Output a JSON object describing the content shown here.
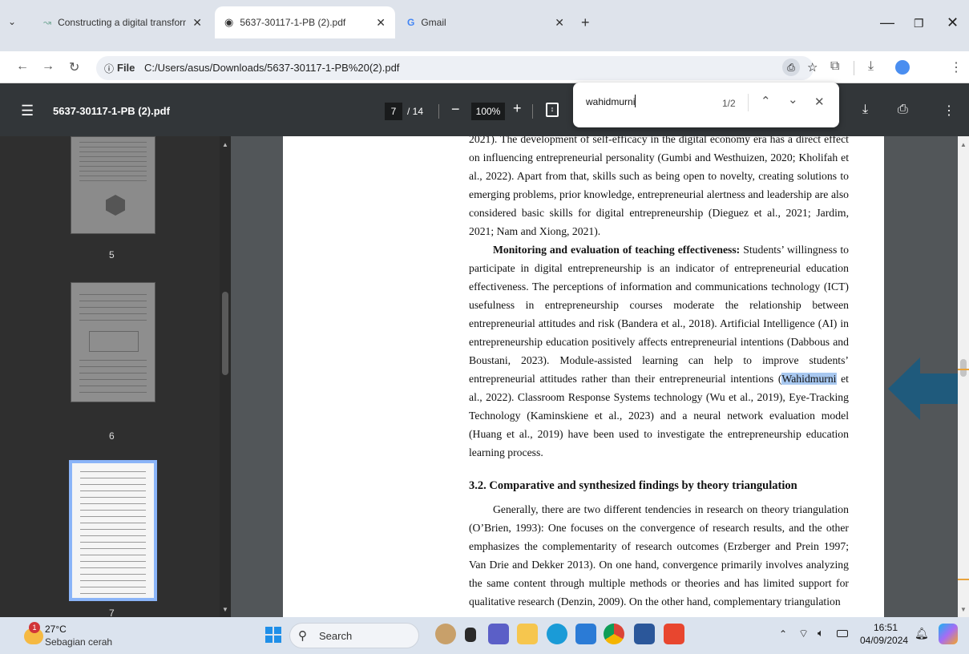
{
  "browser": {
    "tabs": [
      {
        "title": "Constructing a digital transform",
        "active": false
      },
      {
        "title": "5637-30117-1-PB (2).pdf",
        "active": true
      },
      {
        "title": "Gmail",
        "active": false
      }
    ],
    "new_tab_label": "+",
    "address": {
      "scheme_label": "File",
      "url": "C:/Users/asus/Downloads/5637-30117-1-PB%20(2).pdf"
    }
  },
  "pdf_toolbar": {
    "filename": "5637-30117-1-PB (2).pdf",
    "current_page": "7",
    "total_pages": "/ 14",
    "zoom": "100%"
  },
  "find": {
    "query": "wahidmurni",
    "count": "1/2"
  },
  "thumbnails": [
    {
      "label": "5"
    },
    {
      "label": "6"
    },
    {
      "label": "7",
      "selected": true
    }
  ],
  "document": {
    "paragraph_1": "2021). The development of self-efficacy in the digital economy era has a direct effect on influencing entrepreneurial personality (Gumbi and Westhuizen, 2020; Kholifah et al., 2022). Apart from that, skills such as being open to novelty, creating solutions to emerging problems, prior knowledge, entrepreneurial alertness and leadership are also considered basic skills for digital entrepreneurship (Dieguez et al., 2021; Jardim, 2021; Nam and Xiong, 2021).",
    "paragraph_2_heading": "Monitoring and evaluation of teaching effectiveness:",
    "paragraph_2_before_highlight": " Students’ willingness to participate in digital entrepreneurship is an indicator of entrepreneurial education effectiveness. The perceptions of information and communications technology (ICT) usefulness in entrepreneurship courses moderate the relationship between entrepreneurial attitudes and risk (Bandera et al., 2018). Artificial Intelligence (AI) in entrepreneurship education positively affects entrepreneurial intentions (Dabbous and Boustani, 2023). Module-assisted learning can help to improve students’ entrepreneurial attitudes rather than their entrepreneurial intentions (",
    "paragraph_2_highlight": "Wahidmurni",
    "paragraph_2_after_highlight": " et al., 2022). Classroom Response Systems technology (Wu et al., 2019), Eye-Tracking Technology (Kaminskiene et al., 2023) and a neural network evaluation model (Huang et al., 2019) have been used to investigate the entrepreneurship education learning process.",
    "section_heading": "3.2. Comparative and synthesized findings by theory triangulation",
    "paragraph_3": "Generally, there are two different tendencies in research on theory triangulation (O’Brien, 1993): One focuses on the convergence of research results, and the other emphasizes the complementarity of research outcomes (Erzberger and Prein 1997; Van Drie and Dekker 2013). On one hand, convergence primarily involves analyzing the same content through multiple methods or theories and has limited support for qualitative research (Denzin, 2009). On the other hand, complementary triangulation"
  },
  "taskbar": {
    "weather_temp": "27°C",
    "weather_desc": "Sebagian cerah",
    "weather_badge": "1",
    "search_label": "Search",
    "time": "16:51",
    "date": "04/09/2024"
  },
  "colors": {
    "pdf_toolbar": "#323639",
    "doc_background": "#525659",
    "highlight": "#a8c8f0",
    "arrow": "#1f5a7c"
  }
}
